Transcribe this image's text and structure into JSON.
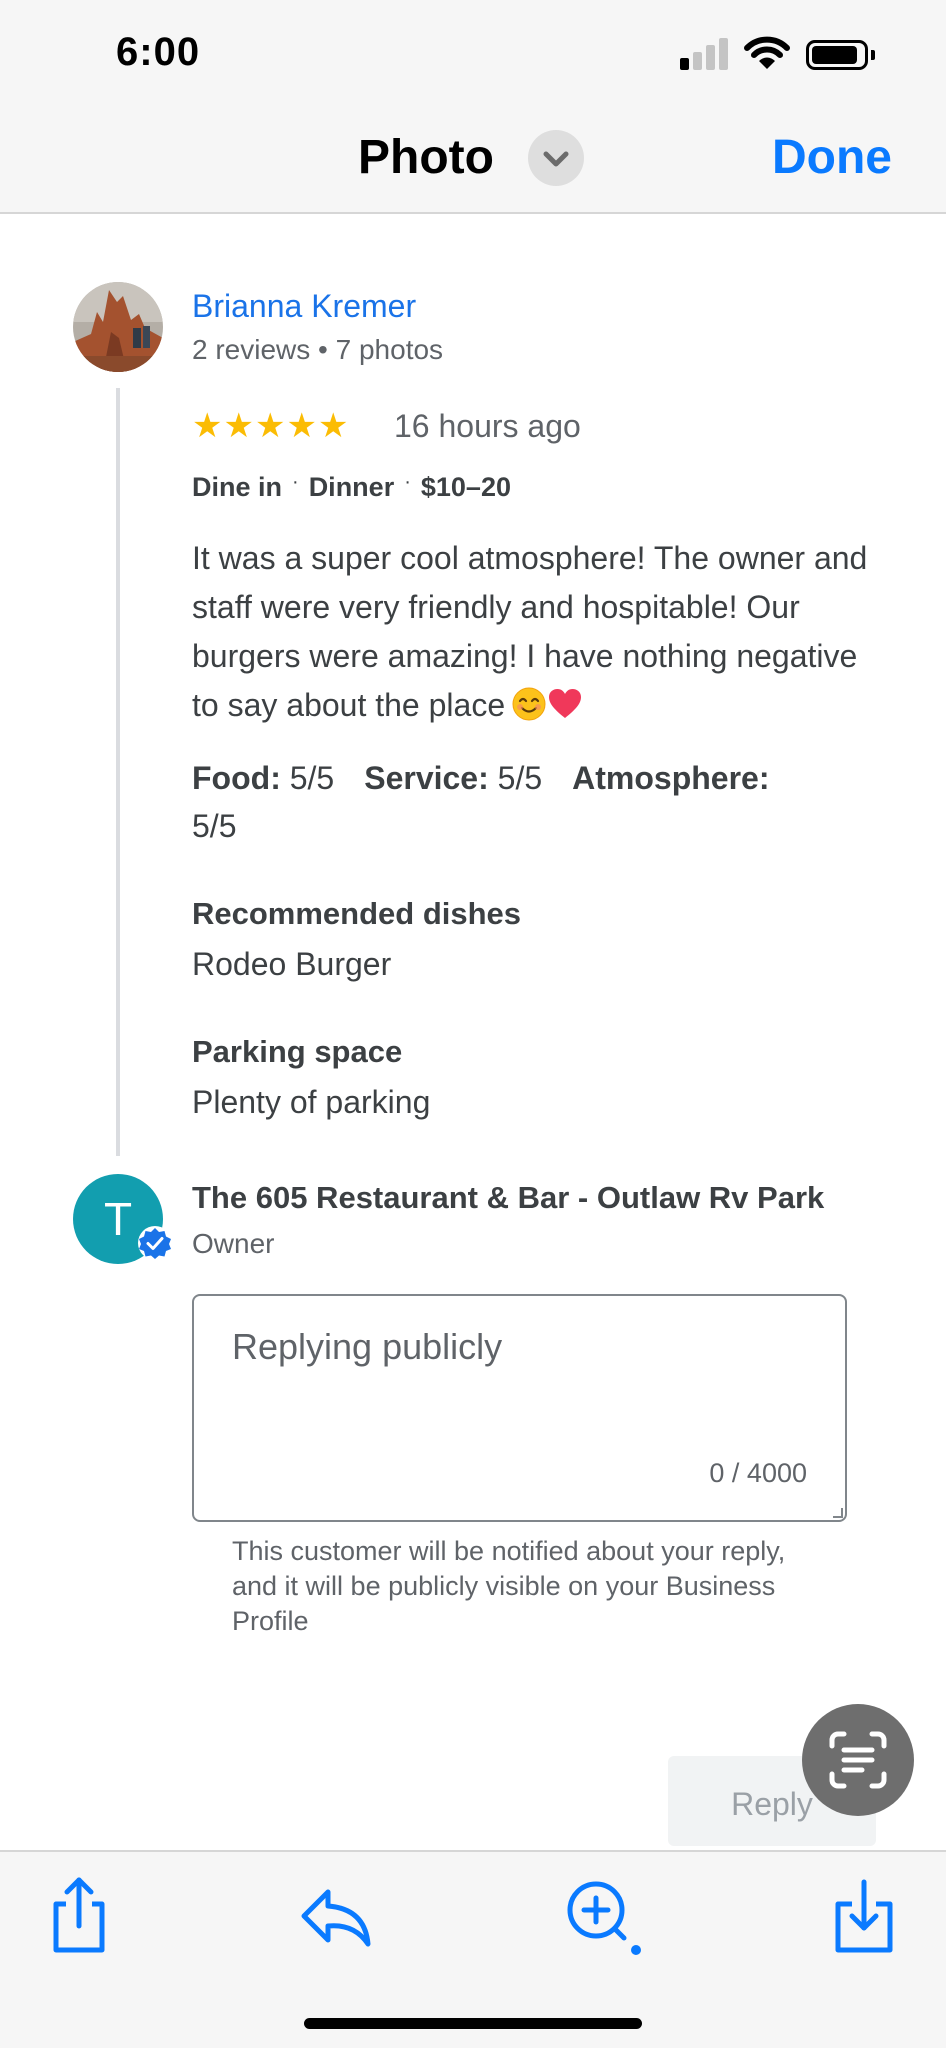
{
  "status_bar": {
    "time": "6:00"
  },
  "nav": {
    "title": "Photo",
    "done_label": "Done"
  },
  "review": {
    "reviewer_name": "Brianna Kremer",
    "reviewer_meta": "2 reviews • 7 photos",
    "rating": 5,
    "time_ago": "16 hours ago",
    "tags": [
      "Dine in",
      "Dinner",
      "$10–20"
    ],
    "text": "It was a super cool atmosphere! The owner and staff were very friendly and hospitable! Our burgers were amazing! I have nothing negative to say about the place",
    "ratings": [
      {
        "label": "Food:",
        "value": "5/5"
      },
      {
        "label": "Service:",
        "value": "5/5"
      },
      {
        "label": "Atmosphere:",
        "value": "5/5"
      }
    ],
    "recommended_title": "Recommended dishes",
    "recommended_value": "Rodeo Burger",
    "parking_title": "Parking space",
    "parking_value": "Plenty of parking"
  },
  "owner": {
    "initial": "T",
    "name": "The 605 Restaurant & Bar - Outlaw Rv Park",
    "role": "Owner",
    "avatar_color": "#129eaf"
  },
  "reply": {
    "placeholder": "Replying publicly",
    "counter": "0 / 4000",
    "hint": "This customer will be notified about your reply, and it will be publicly visible on your Business Profile",
    "button_label": "Reply"
  },
  "toolbar": {
    "icons": [
      "share-icon",
      "reply-arrow-icon",
      "zoom-in-icon",
      "download-icon"
    ]
  },
  "colors": {
    "ios_blue": "#0a7aff",
    "link_blue": "#1a73e8",
    "star_yellow": "#fbbc04",
    "text_gray": "#5f6368"
  }
}
